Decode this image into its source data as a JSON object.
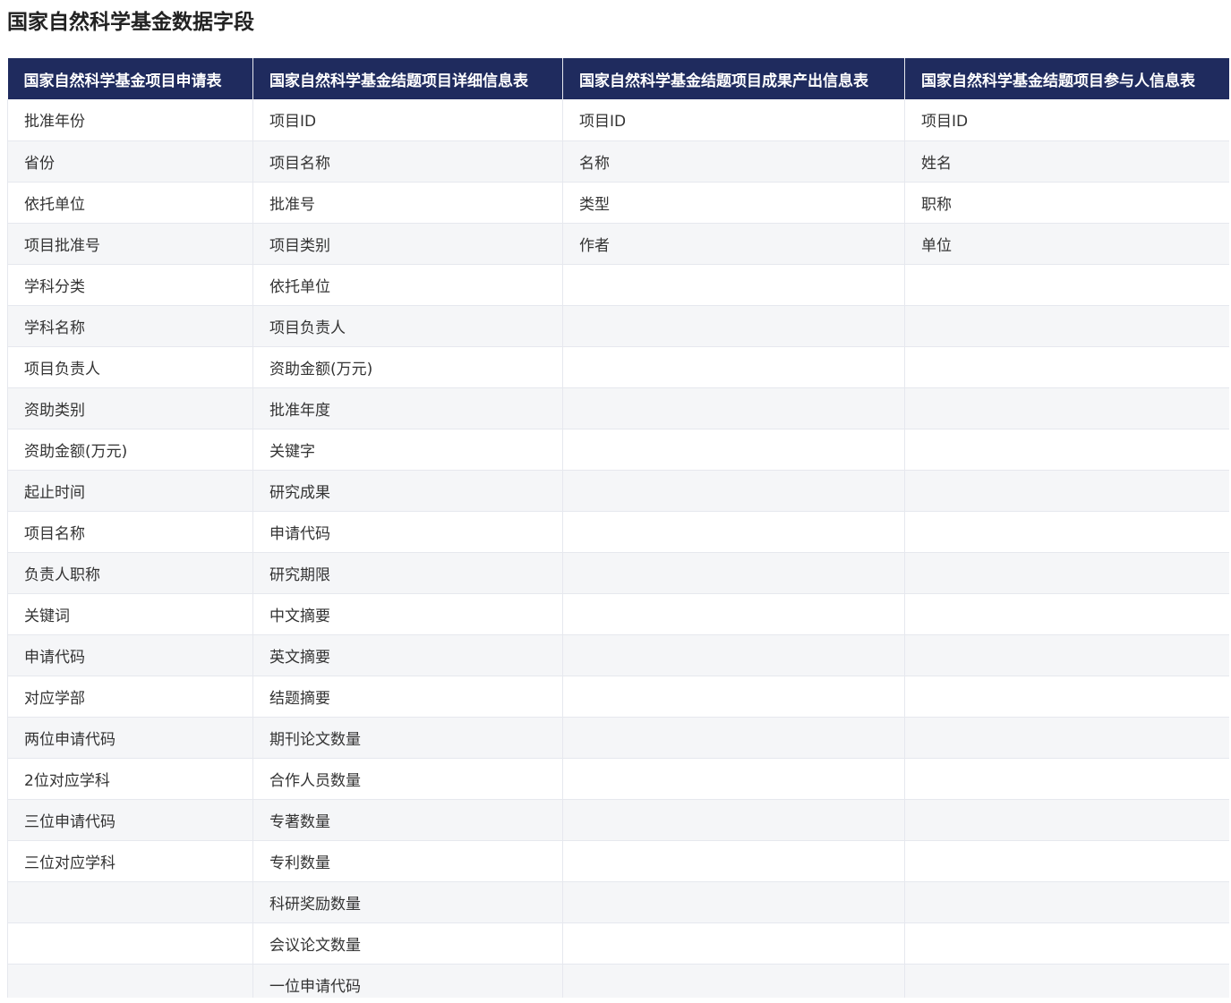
{
  "page": {
    "title": "国家自然科学基金数据字段"
  },
  "table": {
    "headers": [
      "国家自然科学基金项目申请表",
      "国家自然科学基金结题项目详细信息表",
      "国家自然科学基金结题项目成果产出信息表",
      "国家自然科学基金结题项目参与人信息表"
    ],
    "rows": [
      [
        "批准年份",
        "项目ID",
        "项目ID",
        "项目ID"
      ],
      [
        "省份",
        "项目名称",
        "名称",
        "姓名"
      ],
      [
        "依托单位",
        "批准号",
        "类型",
        "职称"
      ],
      [
        "项目批准号",
        "项目类别",
        "作者",
        "单位"
      ],
      [
        "学科分类",
        "依托单位",
        "",
        ""
      ],
      [
        "学科名称",
        "项目负责人",
        "",
        ""
      ],
      [
        "项目负责人",
        "资助金额(万元)",
        "",
        ""
      ],
      [
        "资助类别",
        "批准年度",
        "",
        ""
      ],
      [
        "资助金额(万元)",
        "关键字",
        "",
        ""
      ],
      [
        "起止时间",
        "研究成果",
        "",
        ""
      ],
      [
        "项目名称",
        "申请代码",
        "",
        ""
      ],
      [
        "负责人职称",
        "研究期限",
        "",
        ""
      ],
      [
        "关键词",
        "中文摘要",
        "",
        ""
      ],
      [
        "申请代码",
        "英文摘要",
        "",
        ""
      ],
      [
        "对应学部",
        "结题摘要",
        "",
        ""
      ],
      [
        "两位申请代码",
        "期刊论文数量",
        "",
        ""
      ],
      [
        "2位对应学科",
        "合作人员数量",
        "",
        ""
      ],
      [
        "三位申请代码",
        "专著数量",
        "",
        ""
      ],
      [
        "三位对应学科",
        "专利数量",
        "",
        ""
      ],
      [
        "",
        "科研奖励数量",
        "",
        ""
      ],
      [
        "",
        "会议论文数量",
        "",
        ""
      ],
      [
        "",
        "一位申请代码",
        "",
        ""
      ]
    ]
  },
  "colors": {
    "header_bg": "#1f2b5e",
    "header_text": "#ffffff",
    "row_alt_bg": "#f5f6f8",
    "border": "#e6e8ee"
  }
}
